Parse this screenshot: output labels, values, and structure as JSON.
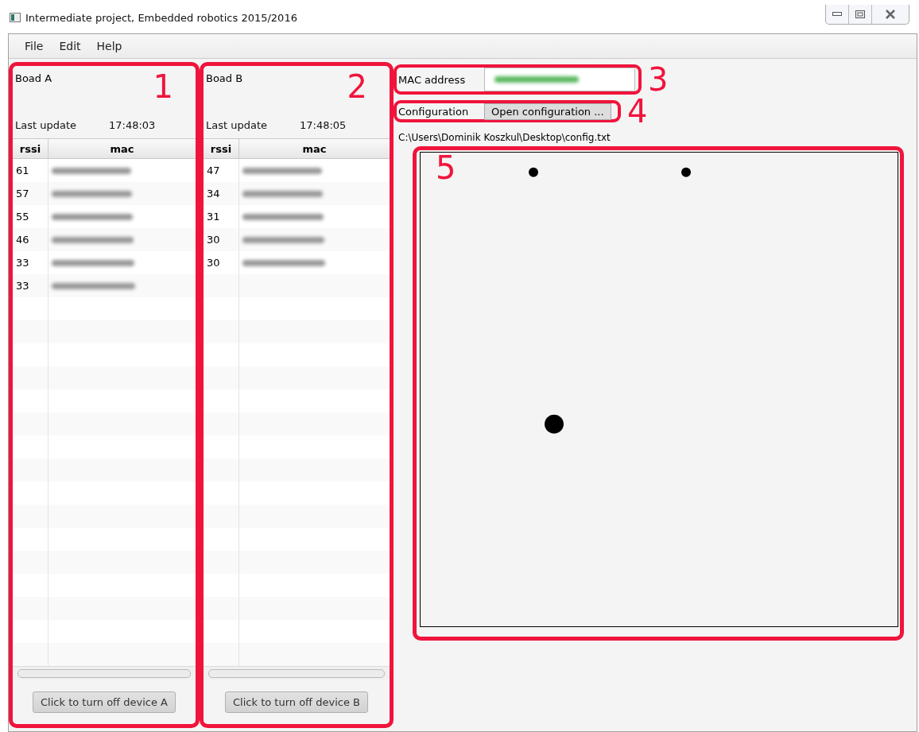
{
  "window": {
    "title": "Intermediate project, Embedded robotics 2015/2016"
  },
  "menu": [
    "File",
    "Edit",
    "Help"
  ],
  "boards": [
    {
      "title": "Boad A",
      "marker": "1",
      "update_label": "Last update",
      "update_time": "17:48:03",
      "columns": [
        "rssi",
        "mac"
      ],
      "rows": [
        "61",
        "57",
        "55",
        "46",
        "33",
        "33"
      ],
      "button": "Click to turn off device A"
    },
    {
      "title": "Boad B",
      "marker": "2",
      "update_label": "Last update",
      "update_time": "17:48:05",
      "columns": [
        "rssi",
        "mac"
      ],
      "rows": [
        "47",
        "34",
        "31",
        "30",
        "30"
      ],
      "button": "Click to turn off device B"
    }
  ],
  "mac": {
    "label": "MAC address",
    "marker": "3"
  },
  "configuration": {
    "label": "Configuration",
    "button": "Open configuration ...",
    "marker": "4",
    "path": "C:\\Users\\Dominik Koszkul\\Desktop\\config.txt"
  },
  "map": {
    "marker": "5"
  }
}
